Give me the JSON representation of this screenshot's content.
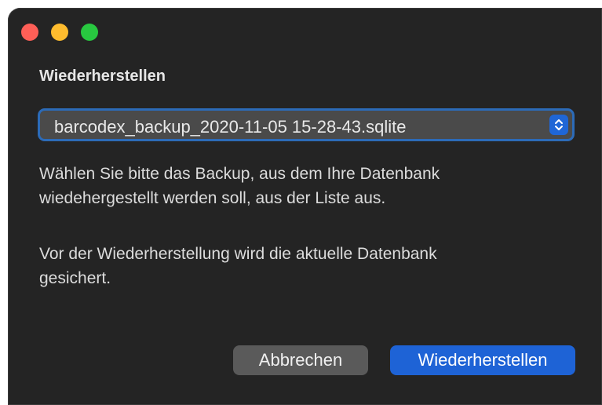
{
  "window": {
    "traffic_lights": {
      "close_color": "#fe5f57",
      "minimize_color": "#febc2e",
      "zoom_color": "#28c840"
    }
  },
  "dialog": {
    "title": "Wiederherstellen",
    "select": {
      "value": "barcodex_backup_2020-11-05 15-28-43.sqlite",
      "icon": "chevron-up-down-icon"
    },
    "message_line1": "Wählen Sie bitte das Backup, aus dem Ihre Datenbank",
    "message_line2": "wiedehergestellt werden soll, aus der Liste aus.",
    "note_line1": "Vor der Wiederherstellung wird die aktuelle Datenbank",
    "note_line2": "gesichert.",
    "cancel_label": "Abbrechen",
    "confirm_label": "Wiederherstellen"
  },
  "colors": {
    "accent": "#1e63d6",
    "window_bg": "#242424"
  }
}
